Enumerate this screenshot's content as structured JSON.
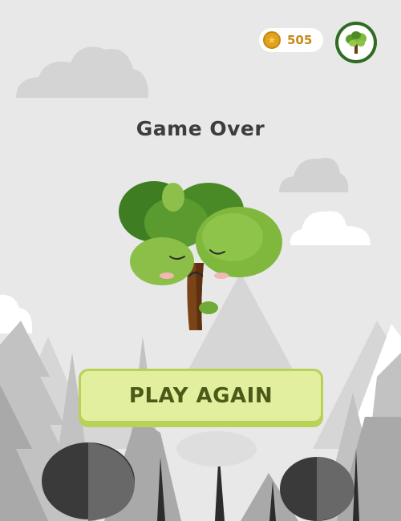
{
  "hud": {
    "coins": "505",
    "coin_icon": "star-coin-icon",
    "avatar_icon": "tree-avatar-icon"
  },
  "game_over": {
    "title": "Game Over",
    "mascot": "sad-tree-character"
  },
  "actions": {
    "play_again_label": "PLAY AGAIN"
  },
  "colors": {
    "background": "#e8e8e8",
    "button_fill": "#e2ef9e",
    "button_border": "#b7d256",
    "button_text": "#4b5a18",
    "coin": "#e1a21f",
    "avatar_ring": "#2f6b20"
  }
}
